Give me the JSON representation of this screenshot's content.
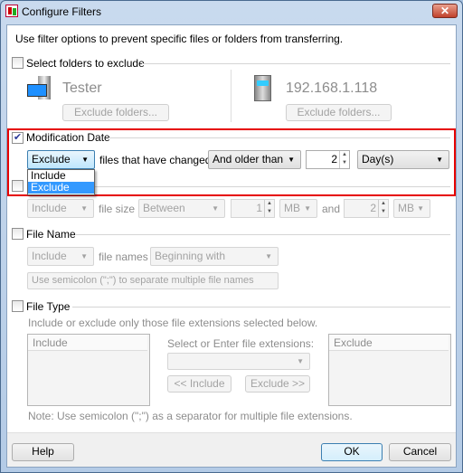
{
  "window": {
    "title": "Configure Filters",
    "close_icon": "close-icon",
    "app_icon": "transfer-app-icon"
  },
  "intro": "Use filter options to prevent specific files or folders from transferring.",
  "folders": {
    "label": "Select folders to exclude",
    "checked": false,
    "local_name": "Tester",
    "remote_name": "192.168.1.118",
    "exclude_button": "Exclude folders..."
  },
  "mod_date": {
    "label": "Modification Date",
    "checked": true,
    "mode": "Exclude",
    "text": "files that have changed",
    "comparison": "And older than",
    "amount": "2",
    "unit": "Day(s)",
    "dropdown_options": [
      "Include",
      "Exclude"
    ],
    "dropdown_selected": "Exclude",
    "highlight_color": "#e60000"
  },
  "file_size": {
    "checked": false,
    "mode": "Include",
    "text": "file size",
    "comparison": "Between",
    "min": "1",
    "min_unit": "MB",
    "and": "and",
    "max": "2",
    "max_unit": "MB"
  },
  "file_name": {
    "label": "File Name",
    "checked": false,
    "mode": "Include",
    "text": "file names",
    "match": "Beginning with",
    "placeholder": "Use semicolon (\";\") to separate multiple file names"
  },
  "file_type": {
    "label": "File Type",
    "checked": false,
    "description": "Include or exclude only those file extensions selected below.",
    "include_header": "Include",
    "exclude_header": "Exclude",
    "select_label": "Select or Enter file extensions:",
    "include_button": "<< Include",
    "exclude_button": "Exclude >>",
    "note": "Note: Use semicolon (\";\") as a separator for multiple file extensions."
  },
  "footer": {
    "help": "Help",
    "ok": "OK",
    "cancel": "Cancel"
  }
}
